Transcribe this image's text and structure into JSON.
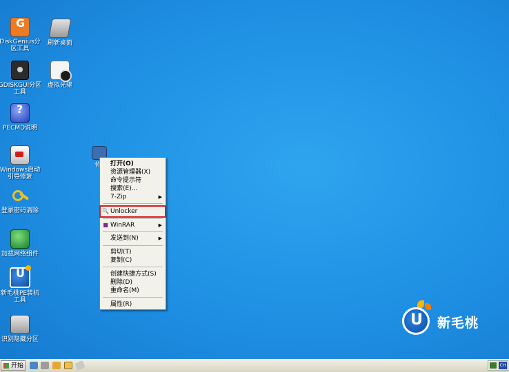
{
  "desktop": {
    "icons": [
      {
        "label": "DiskGenius分区工具",
        "icon": "diskgenius-icon"
      },
      {
        "label": "刷新桌面",
        "icon": "refresh-desktop-icon"
      },
      {
        "label": "GDISKGUI分区工具",
        "icon": "gdisk-icon"
      },
      {
        "label": "虚拟光驱",
        "icon": "virtual-cd-icon"
      },
      {
        "label": "PECMD说明",
        "icon": "help-icon"
      },
      {
        "label": "Windows启动引导修复",
        "icon": "boot-repair-icon"
      },
      {
        "label": "登录密码清除",
        "icon": "key-icon"
      },
      {
        "label": "加载网络组件",
        "icon": "network-icon"
      },
      {
        "label": "新毛桃PE装机工具",
        "icon": "xmt-installer-icon"
      },
      {
        "label": "识别隐藏分区",
        "icon": "drive-icon"
      }
    ],
    "folder_label_partial": "修"
  },
  "context_menu": {
    "items": [
      {
        "label": "打开(O)",
        "bold": true
      },
      {
        "label": "资源管理器(X)"
      },
      {
        "label": "命令提示符"
      },
      {
        "label": "搜索(E)..."
      },
      {
        "label": "7-Zip",
        "submenu": true
      },
      {
        "label": "Unlocker",
        "highlighted": true
      },
      {
        "label": "WinRAR",
        "submenu": true
      },
      {
        "label": "发送到(N)",
        "submenu": true
      },
      {
        "label": "剪切(T)"
      },
      {
        "label": "复制(C)"
      },
      {
        "label": "创建快捷方式(S)"
      },
      {
        "label": "删除(D)"
      },
      {
        "label": "重命名(M)"
      },
      {
        "label": "属性(R)"
      }
    ]
  },
  "watermark": {
    "brand": "新毛桃"
  },
  "taskbar": {
    "start_label": "开始",
    "quick_launch": [
      "desktop-icon",
      "tool-icon",
      "folder-icon",
      "explorer-icon",
      "eraser-icon"
    ],
    "tray_lang": "CH"
  },
  "colors": {
    "desktop": "#1e8fe3",
    "highlight": "#d61c1c",
    "menu_bg": "#f3f2ea"
  }
}
